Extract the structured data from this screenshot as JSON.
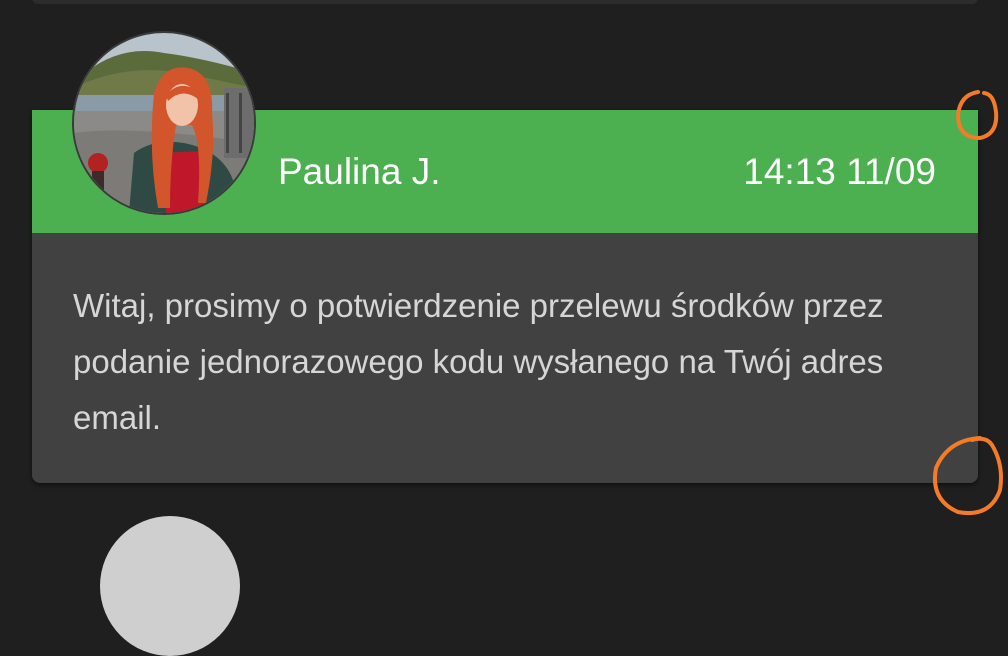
{
  "message": {
    "sender": "Paulina J.",
    "timestamp": "14:13 11/09",
    "body": "Witaj, prosimy o potwierdzenie przelewu środków przez podanie jednorazowego kodu wysłanego na Twój adres email."
  },
  "colors": {
    "background": "#1f1f1f",
    "header_green": "#4caf50",
    "card_body": "#414141",
    "body_text": "#d6d6d6",
    "annotation_orange": "#f47c28"
  },
  "icons": {
    "avatar": "sender-avatar-photo",
    "next_avatar": "next-message-avatar"
  }
}
